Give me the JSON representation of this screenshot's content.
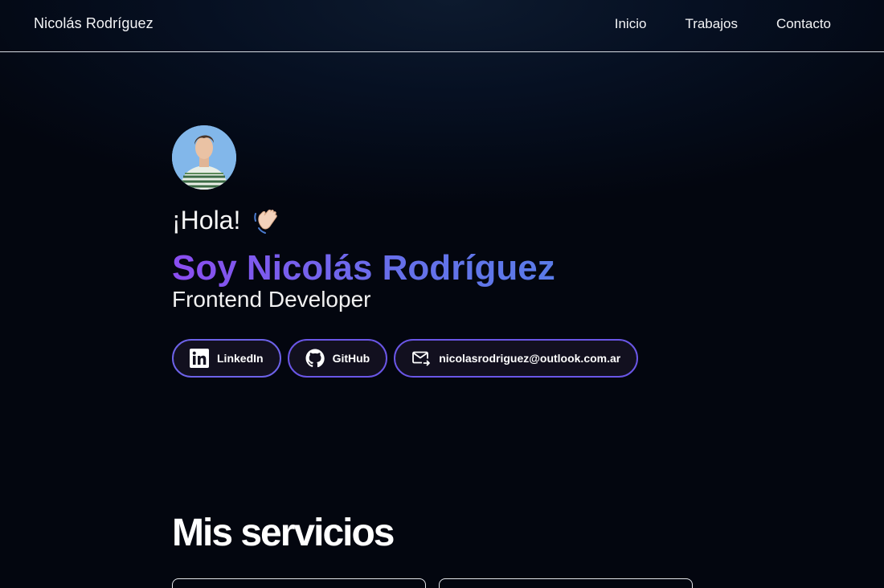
{
  "nav": {
    "brand": "Nicolás Rodríguez",
    "links": [
      "Inicio",
      "Trabajos",
      "Contacto"
    ]
  },
  "hero": {
    "greeting": "¡Hola!",
    "greeting_icon": "waving-hand-icon",
    "headline": "Soy Nicolás Rodríguez",
    "role": "Frontend Developer",
    "avatar_icon": "profile-photo"
  },
  "social": [
    {
      "label": "LinkedIn",
      "icon": "linkedin-icon"
    },
    {
      "label": "GitHub",
      "icon": "github-icon"
    },
    {
      "label": "nicolasrodriguez@outlook.com.ar",
      "icon": "mail-icon"
    }
  ],
  "services": {
    "title": "Mis servicios"
  },
  "colors": {
    "background": "#03060f",
    "accent_start": "#8b4df0",
    "accent_end": "#5a7be8",
    "pill_border": "#6a56e6"
  }
}
